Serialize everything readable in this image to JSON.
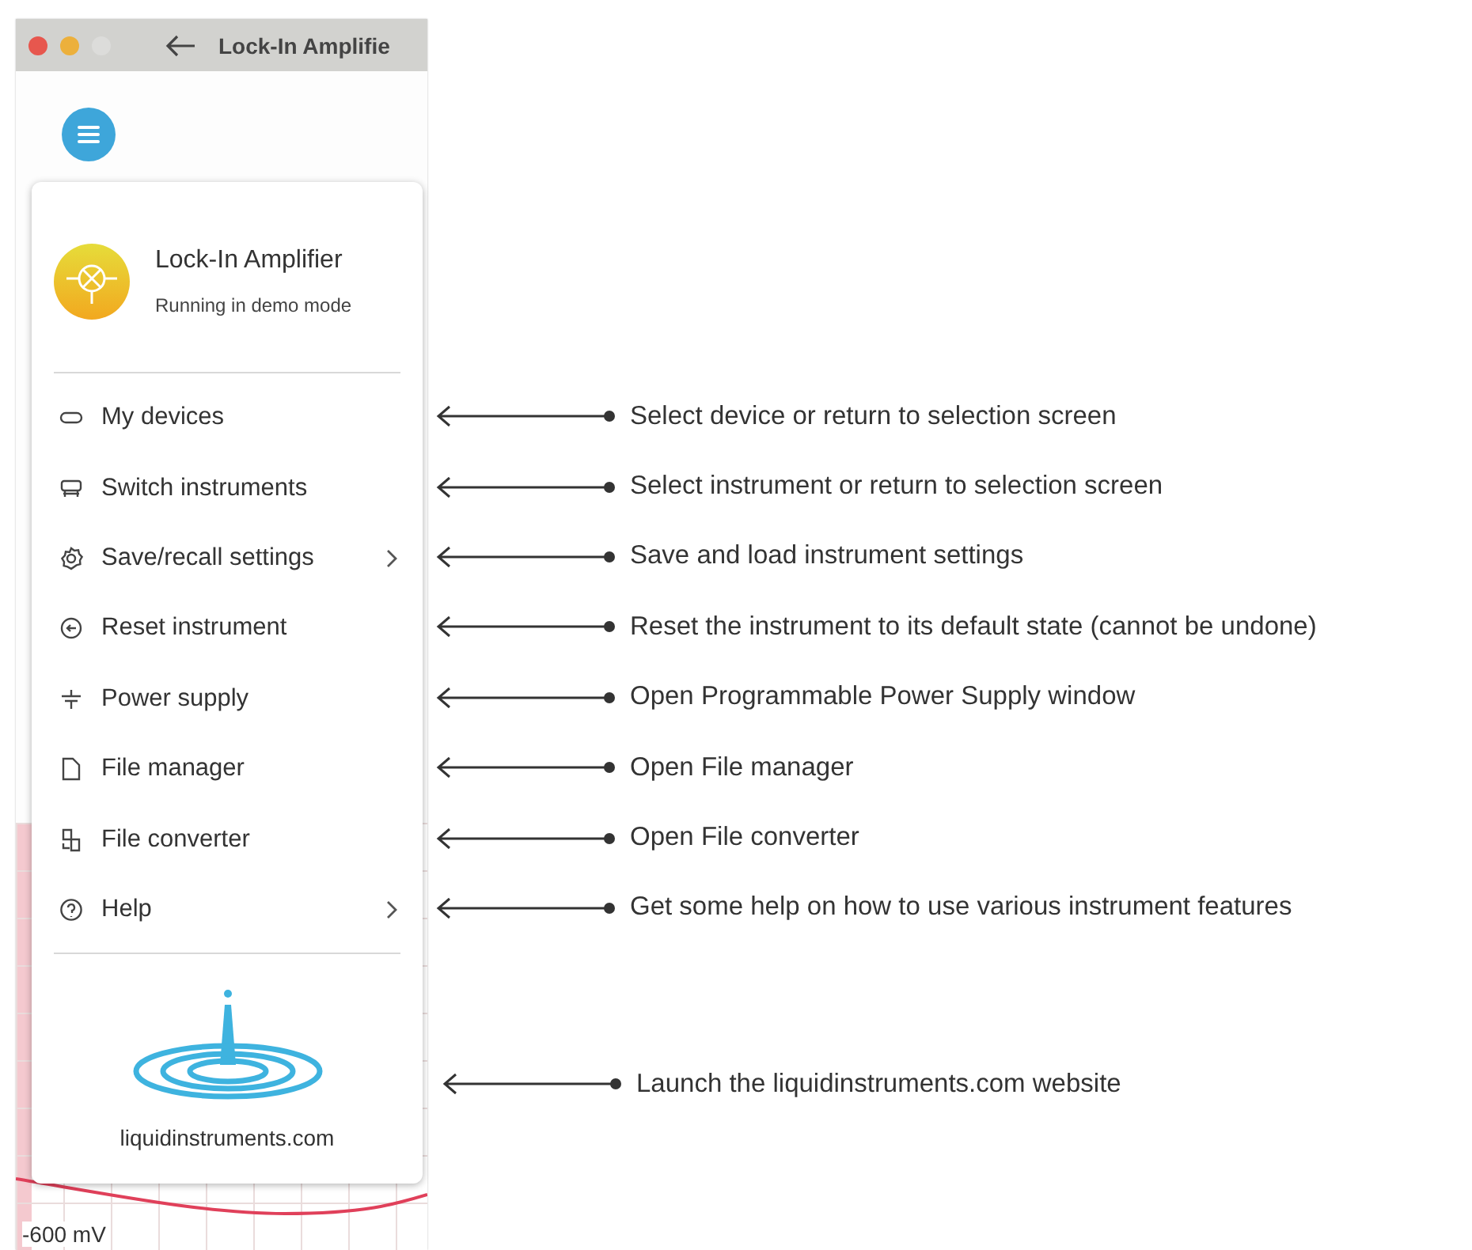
{
  "window": {
    "title": "Lock-In Amplifie"
  },
  "menu": {
    "title": "Lock-In Amplifier",
    "subtitle": "Running in demo mode",
    "items": [
      {
        "label": "My devices",
        "kind": "devices",
        "submenu": false
      },
      {
        "label": "Switch instruments",
        "kind": "switch",
        "submenu": false
      },
      {
        "label": "Save/recall settings",
        "kind": "settings",
        "submenu": true
      },
      {
        "label": "Reset instrument",
        "kind": "reset",
        "submenu": false
      },
      {
        "label": "Power supply",
        "kind": "power",
        "submenu": false
      },
      {
        "label": "File manager",
        "kind": "file",
        "submenu": false
      },
      {
        "label": "File converter",
        "kind": "converter",
        "submenu": false
      },
      {
        "label": "Help",
        "kind": "help",
        "submenu": true
      }
    ],
    "website": "liquidinstruments.com"
  },
  "plot": {
    "axis_label": "-600 mV"
  },
  "annotations": [
    "Select device or return to selection screen",
    "Select instrument or return to selection screen",
    "Save and load instrument settings",
    "Reset the instrument to its default state (cannot be undone)",
    "Open Programmable Power Supply window",
    "Open File manager",
    "Open File converter",
    "Get some help on how to use various instrument features",
    "Launch the liquidinstruments.com website"
  ]
}
